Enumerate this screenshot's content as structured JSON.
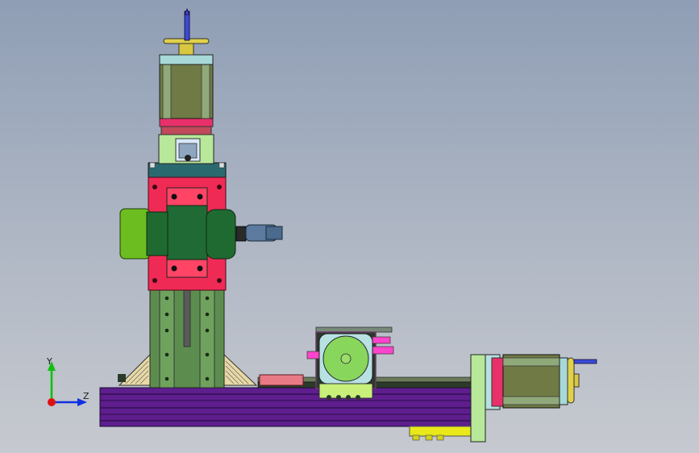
{
  "viewport": {
    "background_top": "#8f9eb5",
    "background_bottom": "#c6c9cf"
  },
  "model": {
    "parts": [
      {
        "name": "vertical-stepper-motor",
        "color": "#6f7a45"
      },
      {
        "name": "spindle-headstock",
        "color": "#ef2b55"
      },
      {
        "name": "spindle-pulley",
        "color": "#6cbd1f"
      },
      {
        "name": "column",
        "color": "#5d8d4e"
      },
      {
        "name": "base-rail",
        "color": "#5e1e8e"
      },
      {
        "name": "cross-slide-motor",
        "color": "#89d65c"
      },
      {
        "name": "horizontal-stepper-motor",
        "color": "#6f7a45"
      },
      {
        "name": "motor-mount-plate",
        "color": "#b8e89a"
      },
      {
        "name": "base-foot",
        "color": "#e8e81a"
      }
    ]
  },
  "triad": {
    "y_label": "Y",
    "z_label": "Z",
    "x_color": "#e01010",
    "y_color": "#10c010",
    "z_color": "#1030e0"
  }
}
